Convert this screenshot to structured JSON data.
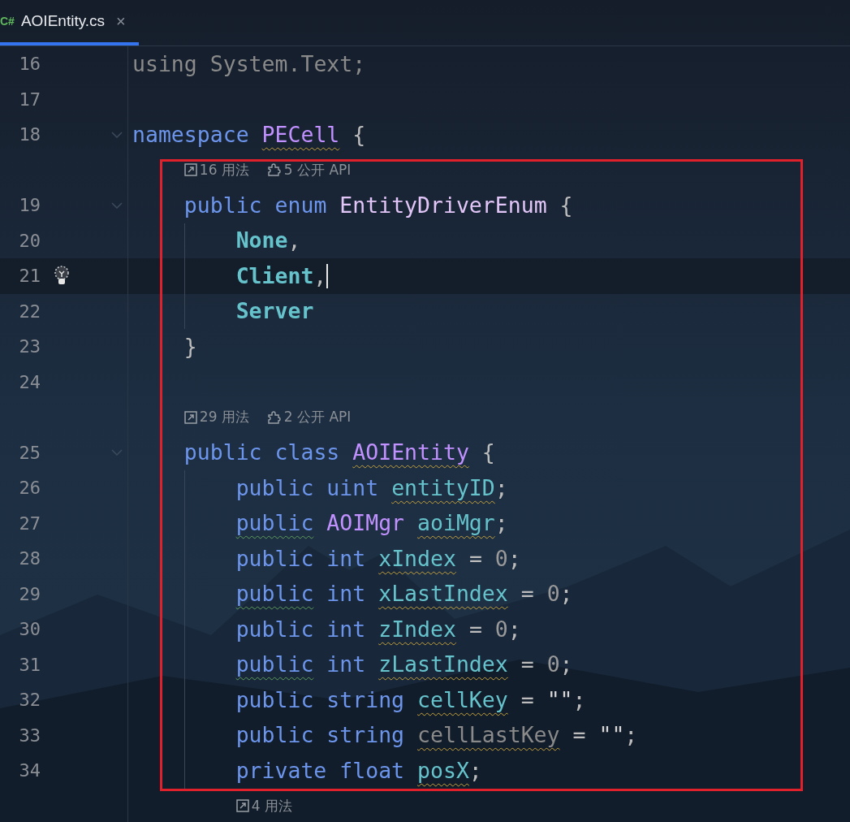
{
  "tabs": [
    {
      "lang": "C#",
      "label": "AOIEntity.cs",
      "close": "×",
      "selected": true
    }
  ],
  "lines": [
    {
      "kind": "code",
      "number": "16",
      "words": [
        {
          "parts": [
            {
              "t": "using",
              "kind": "unused"
            }
          ]
        },
        {
          "parts": [
            {
              "t": "System.Text;",
              "kind": "unused"
            }
          ]
        }
      ]
    },
    {
      "kind": "code",
      "number": "17"
    },
    {
      "kind": "code",
      "number": "18",
      "foldable": true,
      "words": [
        {
          "parts": [
            {
              "t": "namespace",
              "kind": "keyword"
            }
          ]
        },
        {
          "parts": [
            {
              "t": "PECell",
              "kind": "type",
              "warning": true
            }
          ]
        },
        {
          "parts": [
            {
              "t": "{",
              "kind": "punct"
            }
          ]
        }
      ],
      "children": [
        {
          "kind": "hint",
          "usages": "16 用法",
          "api": "5 公开 API"
        },
        {
          "kind": "code",
          "number": "19",
          "foldable": true,
          "words": [
            {
              "parts": [
                {
                  "t": "public",
                  "kind": "keyword"
                }
              ]
            },
            {
              "parts": [
                {
                  "t": "enum",
                  "kind": "keyword"
                }
              ]
            },
            {
              "parts": [
                {
                  "t": "EntityDriverEnum",
                  "kind": "enum_type"
                }
              ]
            },
            {
              "parts": [
                {
                  "t": "{",
                  "kind": "punct"
                }
              ]
            }
          ],
          "children": [
            {
              "kind": "code",
              "number": "20",
              "words": [
                {
                  "parts": [
                    {
                      "t": "None",
                      "kind": "member"
                    },
                    {
                      "t": ",",
                      "kind": "punct"
                    }
                  ]
                }
              ]
            },
            {
              "kind": "code",
              "number": "21",
              "current": true,
              "bulb": true,
              "caret": true,
              "words": [
                {
                  "parts": [
                    {
                      "t": "Client",
                      "kind": "member"
                    },
                    {
                      "t": ",",
                      "kind": "punct"
                    }
                  ]
                }
              ]
            },
            {
              "kind": "code",
              "number": "22",
              "words": [
                {
                  "parts": [
                    {
                      "t": "Server",
                      "kind": "member"
                    }
                  ]
                }
              ]
            }
          ]
        },
        {
          "kind": "code",
          "number": "23",
          "words": [
            {
              "parts": [
                {
                  "t": "}",
                  "kind": "punct"
                }
              ]
            }
          ]
        },
        {
          "kind": "code",
          "number": "24"
        },
        {
          "kind": "hint",
          "usages": "29 用法",
          "api": "2 公开 API"
        },
        {
          "kind": "code",
          "number": "25",
          "foldable": true,
          "words": [
            {
              "parts": [
                {
                  "t": "public",
                  "kind": "keyword"
                }
              ]
            },
            {
              "parts": [
                {
                  "t": "class",
                  "kind": "keyword"
                }
              ]
            },
            {
              "parts": [
                {
                  "t": "AOIEntity",
                  "kind": "type",
                  "warning": true
                }
              ]
            },
            {
              "parts": [
                {
                  "t": "{",
                  "kind": "punct"
                }
              ]
            }
          ],
          "children": [
            {
              "kind": "code",
              "number": "26",
              "words": [
                {
                  "parts": [
                    {
                      "t": "public",
                      "kind": "keyword"
                    }
                  ]
                },
                {
                  "parts": [
                    {
                      "t": "uint",
                      "kind": "keyword"
                    }
                  ]
                },
                {
                  "parts": [
                    {
                      "t": "entityID",
                      "kind": "field",
                      "warning": true
                    },
                    {
                      "t": ";",
                      "kind": "punct"
                    }
                  ]
                }
              ]
            },
            {
              "kind": "code",
              "number": "27",
              "words": [
                {
                  "parts": [
                    {
                      "t": "public",
                      "kind": "keyword",
                      "suggestion": true
                    }
                  ]
                },
                {
                  "parts": [
                    {
                      "t": "AOIMgr",
                      "kind": "type"
                    }
                  ]
                },
                {
                  "parts": [
                    {
                      "t": "aoiMgr",
                      "kind": "field",
                      "warning": true
                    },
                    {
                      "t": ";",
                      "kind": "punct"
                    }
                  ]
                }
              ]
            },
            {
              "kind": "code",
              "number": "28",
              "words": [
                {
                  "parts": [
                    {
                      "t": "public",
                      "kind": "keyword"
                    }
                  ]
                },
                {
                  "parts": [
                    {
                      "t": "int",
                      "kind": "keyword"
                    }
                  ]
                },
                {
                  "parts": [
                    {
                      "t": "xIndex",
                      "kind": "field",
                      "warning": true
                    }
                  ]
                },
                {
                  "parts": [
                    {
                      "t": "=",
                      "kind": "punct"
                    }
                  ]
                },
                {
                  "parts": [
                    {
                      "t": "0",
                      "kind": "number"
                    },
                    {
                      "t": ";",
                      "kind": "punct"
                    }
                  ]
                }
              ]
            },
            {
              "kind": "code",
              "number": "29",
              "words": [
                {
                  "parts": [
                    {
                      "t": "public",
                      "kind": "keyword",
                      "suggestion": true
                    }
                  ]
                },
                {
                  "parts": [
                    {
                      "t": "int",
                      "kind": "keyword"
                    }
                  ]
                },
                {
                  "parts": [
                    {
                      "t": "xLastIndex",
                      "kind": "field",
                      "warning": true
                    }
                  ]
                },
                {
                  "parts": [
                    {
                      "t": "=",
                      "kind": "punct"
                    }
                  ]
                },
                {
                  "parts": [
                    {
                      "t": "0",
                      "kind": "number"
                    },
                    {
                      "t": ";",
                      "kind": "punct"
                    }
                  ]
                }
              ]
            },
            {
              "kind": "code",
              "number": "30",
              "words": [
                {
                  "parts": [
                    {
                      "t": "public",
                      "kind": "keyword"
                    }
                  ]
                },
                {
                  "parts": [
                    {
                      "t": "int",
                      "kind": "keyword"
                    }
                  ]
                },
                {
                  "parts": [
                    {
                      "t": "zIndex",
                      "kind": "field",
                      "warning": true
                    }
                  ]
                },
                {
                  "parts": [
                    {
                      "t": "=",
                      "kind": "punct"
                    }
                  ]
                },
                {
                  "parts": [
                    {
                      "t": "0",
                      "kind": "number"
                    },
                    {
                      "t": ";",
                      "kind": "punct"
                    }
                  ]
                }
              ]
            },
            {
              "kind": "code",
              "number": "31",
              "words": [
                {
                  "parts": [
                    {
                      "t": "public",
                      "kind": "keyword",
                      "suggestion": true
                    }
                  ]
                },
                {
                  "parts": [
                    {
                      "t": "int",
                      "kind": "keyword"
                    }
                  ]
                },
                {
                  "parts": [
                    {
                      "t": "zLastIndex",
                      "kind": "field",
                      "warning": true
                    }
                  ]
                },
                {
                  "parts": [
                    {
                      "t": "=",
                      "kind": "punct"
                    }
                  ]
                },
                {
                  "parts": [
                    {
                      "t": "0",
                      "kind": "number"
                    },
                    {
                      "t": ";",
                      "kind": "punct"
                    }
                  ]
                }
              ]
            },
            {
              "kind": "code",
              "number": "32",
              "words": [
                {
                  "parts": [
                    {
                      "t": "public",
                      "kind": "keyword"
                    }
                  ]
                },
                {
                  "parts": [
                    {
                      "t": "string",
                      "kind": "keyword"
                    }
                  ]
                },
                {
                  "parts": [
                    {
                      "t": "cellKey",
                      "kind": "field",
                      "warning": true
                    }
                  ]
                },
                {
                  "parts": [
                    {
                      "t": "=",
                      "kind": "punct"
                    }
                  ]
                },
                {
                  "parts": [
                    {
                      "t": "\"\"",
                      "kind": "string"
                    },
                    {
                      "t": ";",
                      "kind": "punct"
                    }
                  ]
                }
              ]
            },
            {
              "kind": "code",
              "number": "33",
              "words": [
                {
                  "parts": [
                    {
                      "t": "public",
                      "kind": "keyword"
                    }
                  ]
                },
                {
                  "parts": [
                    {
                      "t": "string",
                      "kind": "keyword"
                    }
                  ]
                },
                {
                  "parts": [
                    {
                      "t": "cellLastKey",
                      "kind": "unused",
                      "warning": true
                    }
                  ]
                },
                {
                  "parts": [
                    {
                      "t": "=",
                      "kind": "punct"
                    }
                  ]
                },
                {
                  "parts": [
                    {
                      "t": "\"\"",
                      "kind": "string"
                    },
                    {
                      "t": ";",
                      "kind": "punct"
                    }
                  ]
                }
              ]
            },
            {
              "kind": "code",
              "number": "34",
              "words": [
                {
                  "parts": [
                    {
                      "t": "private",
                      "kind": "keyword"
                    }
                  ]
                },
                {
                  "parts": [
                    {
                      "t": "float",
                      "kind": "keyword"
                    }
                  ]
                },
                {
                  "parts": [
                    {
                      "t": "posX",
                      "kind": "field",
                      "warning": true
                    },
                    {
                      "t": ";",
                      "kind": "punct"
                    }
                  ]
                }
              ]
            },
            {
              "kind": "hint",
              "usages": "4 用法"
            }
          ]
        }
      ]
    }
  ]
}
